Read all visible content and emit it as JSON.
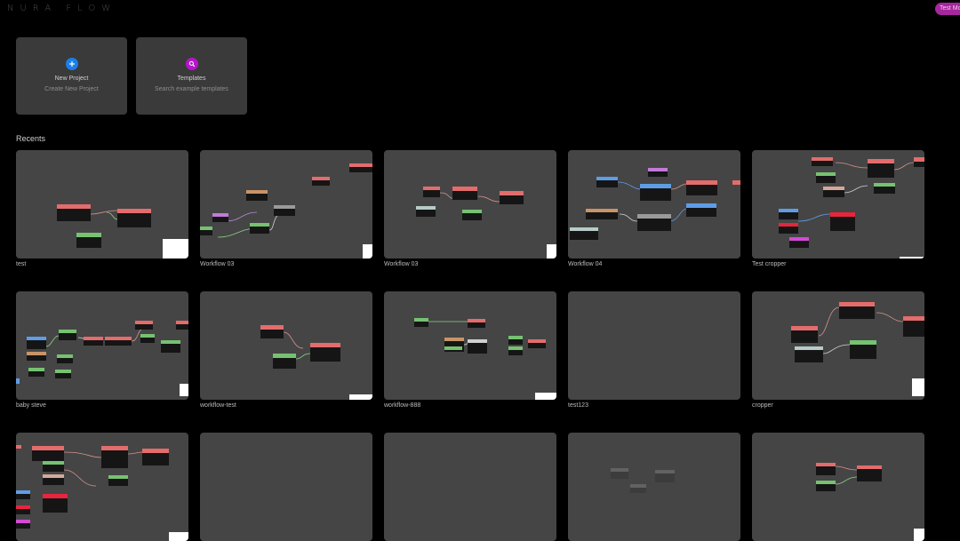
{
  "app": {
    "logo_text": "NURA FLOW",
    "user_badge": "Test Mon"
  },
  "actions": [
    {
      "title": "New Project",
      "subtitle": "Create New Project",
      "icon": "plus-icon",
      "color": "#1a7fe8"
    },
    {
      "title": "Templates",
      "subtitle": "Search example templates",
      "icon": "search-icon",
      "color": "#b416c9"
    }
  ],
  "recents": {
    "title": "Recents",
    "projects": [
      {
        "name": "test"
      },
      {
        "name": "Workflow 03"
      },
      {
        "name": "Workflow 03"
      },
      {
        "name": "Workflow 04"
      },
      {
        "name": "Test cropper"
      },
      {
        "name": "baby steve"
      },
      {
        "name": "workflow-test"
      },
      {
        "name": "workflow-888"
      },
      {
        "name": "test123"
      },
      {
        "name": "cropper"
      },
      {
        "name": ""
      },
      {
        "name": ""
      },
      {
        "name": ""
      },
      {
        "name": ""
      },
      {
        "name": ""
      }
    ]
  }
}
